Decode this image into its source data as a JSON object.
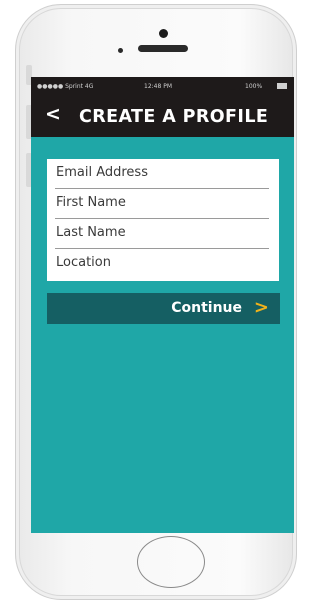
{
  "status_bar": {
    "carrier": "●●●●● Sprint 4G",
    "time": "12:48 PM",
    "battery": "100%"
  },
  "nav": {
    "back_glyph": "<",
    "title": "CREATE A PROFILE"
  },
  "form": {
    "fields": [
      {
        "label": "Email Address"
      },
      {
        "label": "First Name"
      },
      {
        "label": "Last Name"
      },
      {
        "label": "Location"
      }
    ]
  },
  "actions": {
    "continue_label": "Continue",
    "continue_glyph": ">"
  },
  "colors": {
    "screen_bg": "#1fa7a7",
    "navbar_bg": "#1e1a1a",
    "button_bg": "#155f63",
    "accent": "#f0b21b"
  }
}
